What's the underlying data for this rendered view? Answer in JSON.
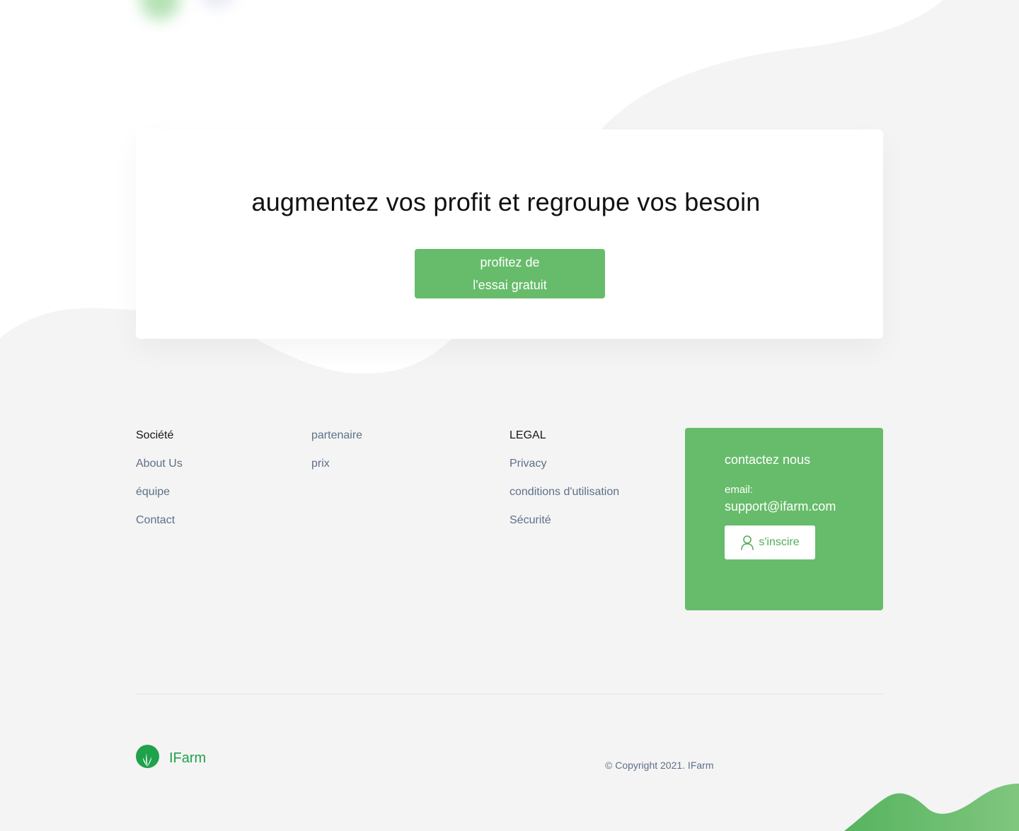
{
  "cta": {
    "title": "augmentez vos profit et regroupe vos besoin",
    "button_line1": "profitez de",
    "button_line2": "l'essai gratuit"
  },
  "footer": {
    "columns": [
      {
        "heading": "Société",
        "links": [
          "About Us",
          "équipe",
          "Contact"
        ]
      },
      {
        "heading": "",
        "links": [
          "partenaire",
          "prix"
        ]
      },
      {
        "heading": "LEGAL",
        "links": [
          "Privacy",
          "conditions d'utilisation",
          "Sécurité"
        ]
      }
    ],
    "contact": {
      "title": "contactez nous",
      "email_label": "email:",
      "email": "support@ifarm.com",
      "signup_label": "s'inscire",
      "signup_icon": "user-icon"
    },
    "brand": {
      "name": "IFarm",
      "logo_icon": "leaf-logo-icon"
    },
    "copyright": "© Copyright 2021. IFarm"
  },
  "colors": {
    "primary_green": "#66bc6a",
    "brand_green": "#1fa24b",
    "link_gray": "#5e7088",
    "background_gray": "#f4f4f4"
  }
}
